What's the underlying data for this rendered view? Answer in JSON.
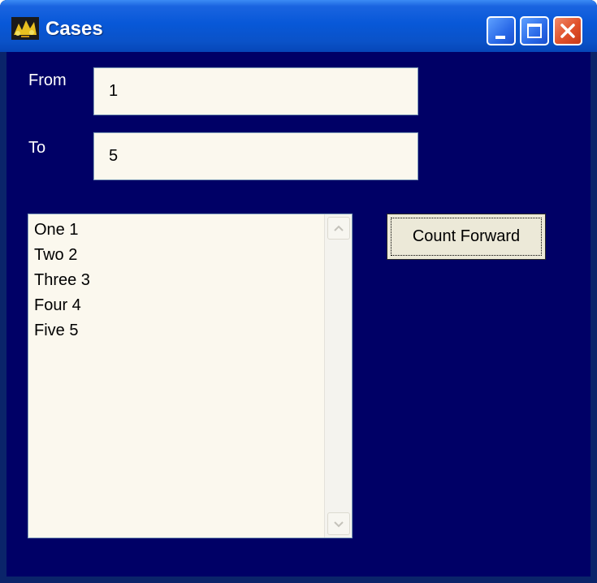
{
  "window": {
    "title": "Cases",
    "icon": "app-icon",
    "controls": {
      "minimize": "minimize-icon",
      "maximize": "maximize-icon",
      "close": "close-icon"
    }
  },
  "form": {
    "from_label": "From",
    "from_value": "1",
    "to_label": "To",
    "to_value": "5"
  },
  "list": {
    "items": [
      "One 1",
      "Two 2",
      "Three 3",
      "Four 4",
      "Five 5"
    ]
  },
  "button": {
    "count_forward_label": "Count Forward"
  },
  "colors": {
    "client_background": "#000066",
    "titlebar": "#0858d8",
    "field_background": "#fbf8ee",
    "button_face": "#ece9d8"
  }
}
